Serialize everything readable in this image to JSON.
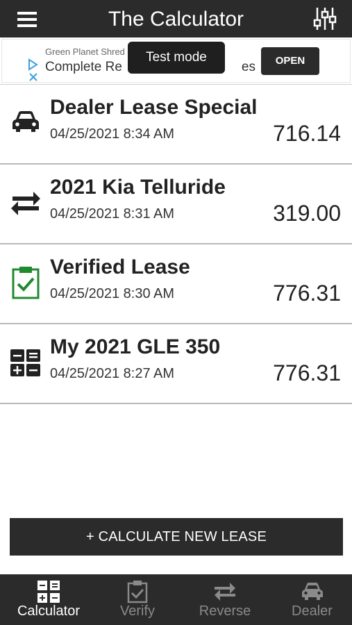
{
  "header": {
    "title": "The Calculator",
    "menu_icon": "hamburger-menu-icon",
    "settings_icon": "sliders-settings-icon"
  },
  "ad": {
    "sponsor": "Green Planet Shred",
    "headline": "Complete Re",
    "headline_tail": "es",
    "open_label": "OPEN",
    "test_mode_label": "Test mode"
  },
  "leases": [
    {
      "name": "Dealer Lease Special",
      "date": "04/25/2021 8:34 AM",
      "amount": "716.14",
      "icon": "car-icon"
    },
    {
      "name": "2021 Kia Telluride",
      "date": "04/25/2021 8:31 AM",
      "amount": "319.00",
      "icon": "reverse-arrows-icon"
    },
    {
      "name": "Verified Lease",
      "date": "04/25/2021 8:30 AM",
      "amount": "776.31",
      "icon": "clipboard-check-icon"
    },
    {
      "name": "My 2021 GLE 350",
      "date": "04/25/2021 8:27 AM",
      "amount": "776.31",
      "icon": "calculator-icon"
    }
  ],
  "cta": {
    "label": "+ CALCULATE NEW LEASE"
  },
  "tabs": [
    {
      "label": "Calculator",
      "icon": "calculator-icon",
      "active": true
    },
    {
      "label": "Verify",
      "icon": "clipboard-check-icon",
      "active": false
    },
    {
      "label": "Reverse",
      "icon": "reverse-arrows-icon",
      "active": false
    },
    {
      "label": "Dealer",
      "icon": "car-icon",
      "active": false
    }
  ],
  "colors": {
    "bar": "#2b2b2b",
    "verified_green": "#1f8a2e",
    "tab_inactive": "#8a8a8a"
  }
}
